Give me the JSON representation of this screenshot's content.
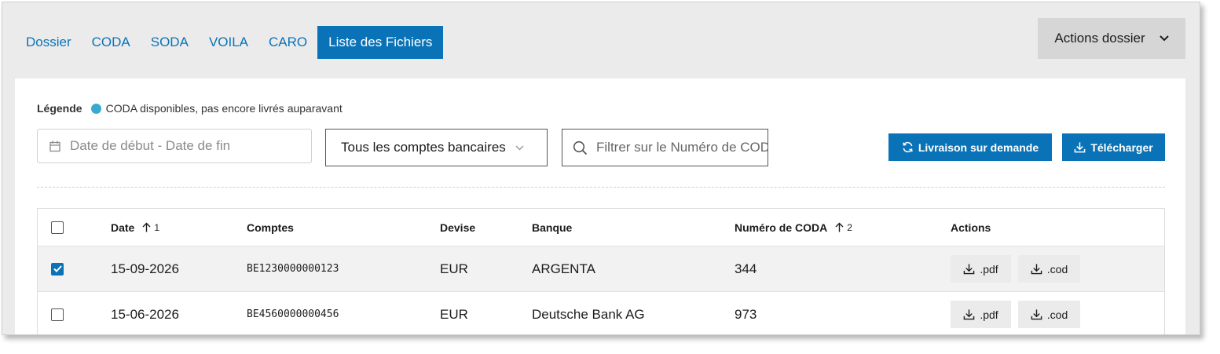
{
  "tabs": [
    {
      "label": "Dossier",
      "active": false
    },
    {
      "label": "CODA",
      "active": false
    },
    {
      "label": "SODA",
      "active": false
    },
    {
      "label": "VOILA",
      "active": false
    },
    {
      "label": "CARO",
      "active": false
    },
    {
      "label": "Liste des Fichiers",
      "active": true
    }
  ],
  "actions_dossier": {
    "label": "Actions dossier"
  },
  "legend": {
    "label": "Légende",
    "text": "CODA disponibles, pas encore livrés auparavant",
    "dot_color": "#3aa9cf"
  },
  "filters": {
    "date_placeholder": "Date de début - Date de fin",
    "account_select": "Tous les comptes bancaires",
    "search_placeholder": "Filtrer sur le Numéro de CODA"
  },
  "buttons": {
    "livraison": "Livraison sur demande",
    "telecharger": "Télécharger"
  },
  "table": {
    "headers": {
      "date": "Date",
      "date_sort": "1",
      "comptes": "Comptes",
      "devise": "Devise",
      "banque": "Banque",
      "numero": "Numéro de CODA",
      "numero_sort": "2",
      "actions": "Actions"
    },
    "rows": [
      {
        "checked": true,
        "date": "15-09-2026",
        "compte": "BE1230000000123",
        "devise": "EUR",
        "banque": "ARGENTA",
        "numero": "344",
        "pdf": ".pdf",
        "cod": ".cod"
      },
      {
        "checked": false,
        "date": "15-06-2026",
        "compte": "BE4560000000456",
        "devise": "EUR",
        "banque": "Deutsche Bank AG",
        "numero": "973",
        "pdf": ".pdf",
        "cod": ".cod"
      }
    ]
  },
  "colors": {
    "accent": "#0a73b8"
  }
}
